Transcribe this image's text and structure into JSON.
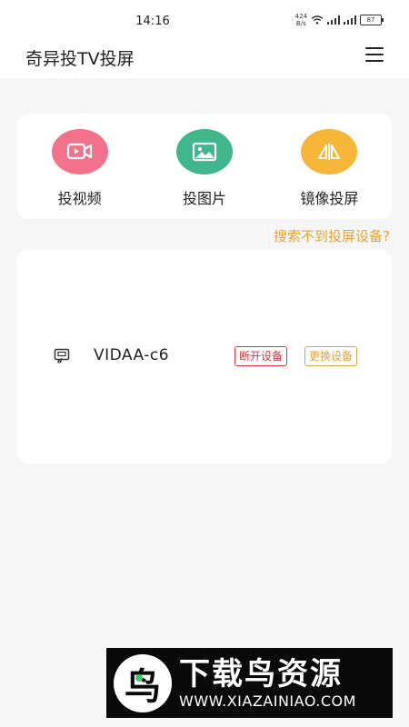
{
  "status_bar": {
    "time": "14:16",
    "net_speed_value": "424",
    "net_speed_unit": "B/s",
    "battery": "87"
  },
  "header": {
    "title": "奇异投TV投屏",
    "menu_icon": "hamburger-menu-icon"
  },
  "actions": [
    {
      "label": "投视频",
      "icon": "video-icon",
      "color": "#f2728c"
    },
    {
      "label": "投图片",
      "icon": "image-icon",
      "color": "#3fb68b"
    },
    {
      "label": "镜像投屏",
      "icon": "mirror-icon",
      "color": "#f6b738"
    }
  ],
  "help_link": "搜索不到投屏设备?",
  "device": {
    "name": "VIDAA-c6",
    "icon": "tv-cast-icon",
    "disconnect_label": "断开设备",
    "change_label": "更换设备"
  },
  "watermark": {
    "title": "下载鸟资源",
    "url": "WWW.XIAZAINIAO.COM"
  },
  "colors": {
    "accent_orange": "#e4a436",
    "danger_red": "#d9363e",
    "background": "#f6f6f6"
  }
}
